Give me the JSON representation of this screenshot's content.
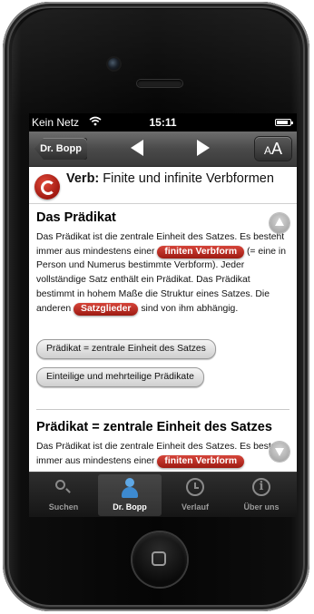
{
  "status_bar": {
    "carrier": "Kein Netz",
    "wifi_icon": "wifi-icon",
    "time": "15:11",
    "battery_icon": "battery-icon"
  },
  "nav_bar": {
    "back_label": "Dr. Bopp",
    "prev_icon": "triangle-left-icon",
    "next_icon": "triangle-right-icon",
    "font_size_label_small": "A",
    "font_size_label_big": "A"
  },
  "chapter": {
    "logo_icon": "c-logo-icon",
    "title_bold": "Verb:",
    "title_rest": "Finite und infinite Verbformen"
  },
  "section1": {
    "heading": "Das Prädikat",
    "text_a": "Das Prädikat ist die zentrale Einheit des Satzes. Es besteht immer aus mindestens einer",
    "link1": "finiten Verbform",
    "text_b": "(= eine in Person und Numerus bestimmte Verbform). Jeder vollständige Satz enthält ein Prädikat. Das Prädikat bestimmt in hohem Maße die Struktur eines Satzes. Die anderen",
    "link2": "Satzglieder",
    "text_c": "sind von ihm abhängig.",
    "button1": "Prädikat = zentrale Einheit des Satzes",
    "button2": "Einteilige und mehrteilige Prädikate"
  },
  "section2": {
    "heading": "Prädikat = zentrale Einheit des Satzes",
    "text_a": "Das Prädikat ist die zentrale Einheit des Satzes. Es besteht immer aus mindestens einer",
    "link1": "finiten Verbform"
  },
  "tabs": [
    {
      "label": "Suchen",
      "icon": "search-icon"
    },
    {
      "label": "Dr. Bopp",
      "icon": "person-icon"
    },
    {
      "label": "Verlauf",
      "icon": "clock-icon"
    },
    {
      "label": "Über uns",
      "icon": "info-icon"
    }
  ],
  "colors": {
    "accent_red": "#b3261d",
    "nav_gray": "#4a4a4a",
    "tab_bar": "#1e1e1e"
  }
}
